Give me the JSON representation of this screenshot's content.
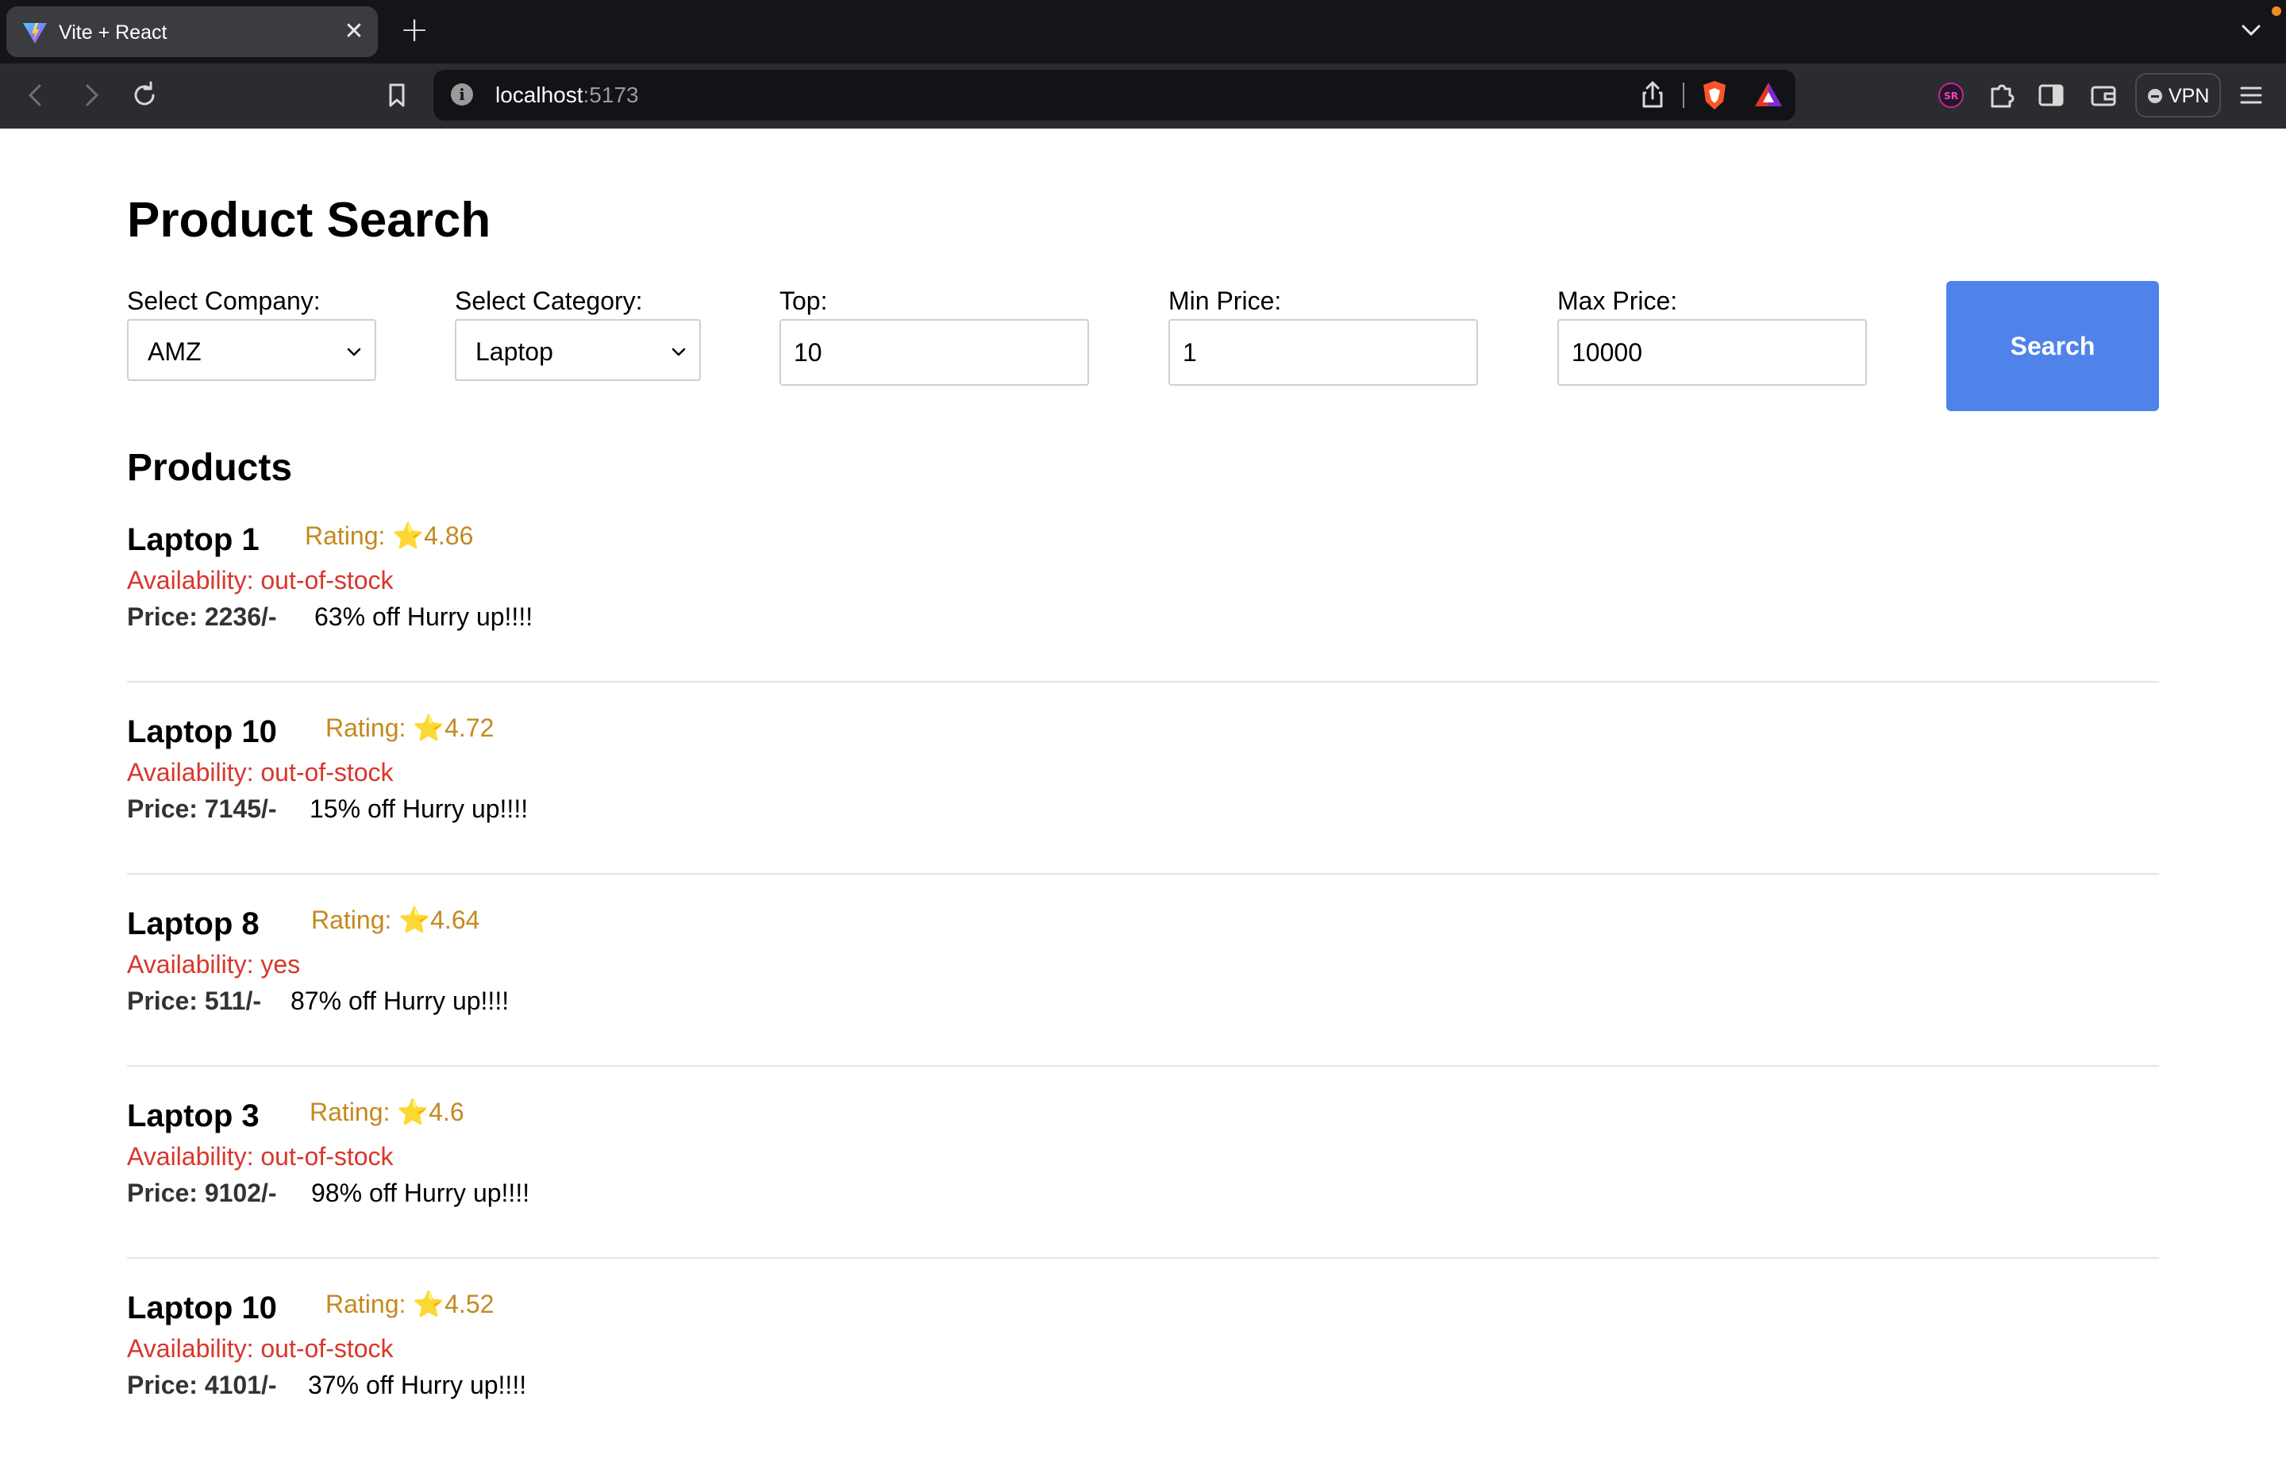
{
  "browser": {
    "tab_title": "Vite + React",
    "url_host": "localhost",
    "url_port": ":5173",
    "vpn_label": "VPN",
    "icons": [
      "vite-favicon",
      "close-icon",
      "plus-icon",
      "chevron-down-icon",
      "back-arrow-icon",
      "forward-arrow-icon",
      "reload-icon",
      "bookmark-icon",
      "info-icon",
      "share-icon",
      "brave-shield-icon",
      "brave-rewards-icon",
      "extension-sr-icon",
      "puzzle-icon",
      "sidebar-icon",
      "wallet-icon",
      "menu-icon"
    ],
    "colors": {
      "tabbar": "#141518",
      "toolbar": "#2b2c30",
      "urlbar": "#121316"
    }
  },
  "page": {
    "title": "Product Search",
    "filters": {
      "company_label": "Select Company:",
      "company_value": "AMZ",
      "category_label": "Select Category:",
      "category_value": "Laptop",
      "top_label": "Top:",
      "top_value": "10",
      "min_label": "Min Price:",
      "min_value": "1",
      "max_label": "Max Price:",
      "max_value": "10000",
      "search_label": "Search"
    },
    "products_heading": "Products",
    "products": [
      {
        "name": "Laptop 1",
        "rating_label": "Rating:",
        "star": "⭐",
        "rating": "4.86",
        "availability": "Availability: out-of-stock",
        "price": "Price: 2236/-",
        "discount": "63% off Hurry up!!!!"
      },
      {
        "name": "Laptop 10",
        "rating_label": "Rating:",
        "star": "⭐",
        "rating": "4.72",
        "availability": "Availability: out-of-stock",
        "price": "Price: 7145/-",
        "discount": "15% off Hurry up!!!!"
      },
      {
        "name": "Laptop 8",
        "rating_label": "Rating:",
        "star": "⭐",
        "rating": "4.64",
        "availability": "Availability: yes",
        "price": "Price: 511/-",
        "discount": "87% off Hurry up!!!!"
      },
      {
        "name": "Laptop 3",
        "rating_label": "Rating:",
        "star": "⭐",
        "rating": "4.6",
        "availability": "Availability: out-of-stock",
        "price": "Price: 9102/-",
        "discount": "98% off Hurry up!!!!"
      },
      {
        "name": "Laptop 10",
        "rating_label": "Rating:",
        "star": "⭐",
        "rating": "4.52",
        "availability": "Availability: out-of-stock",
        "price": "Price: 4101/-",
        "discount": "37% off Hurry up!!!!"
      }
    ],
    "colors": {
      "accent": "#4f83ea",
      "rating": "#c4891e",
      "availability": "#d9362b"
    }
  }
}
